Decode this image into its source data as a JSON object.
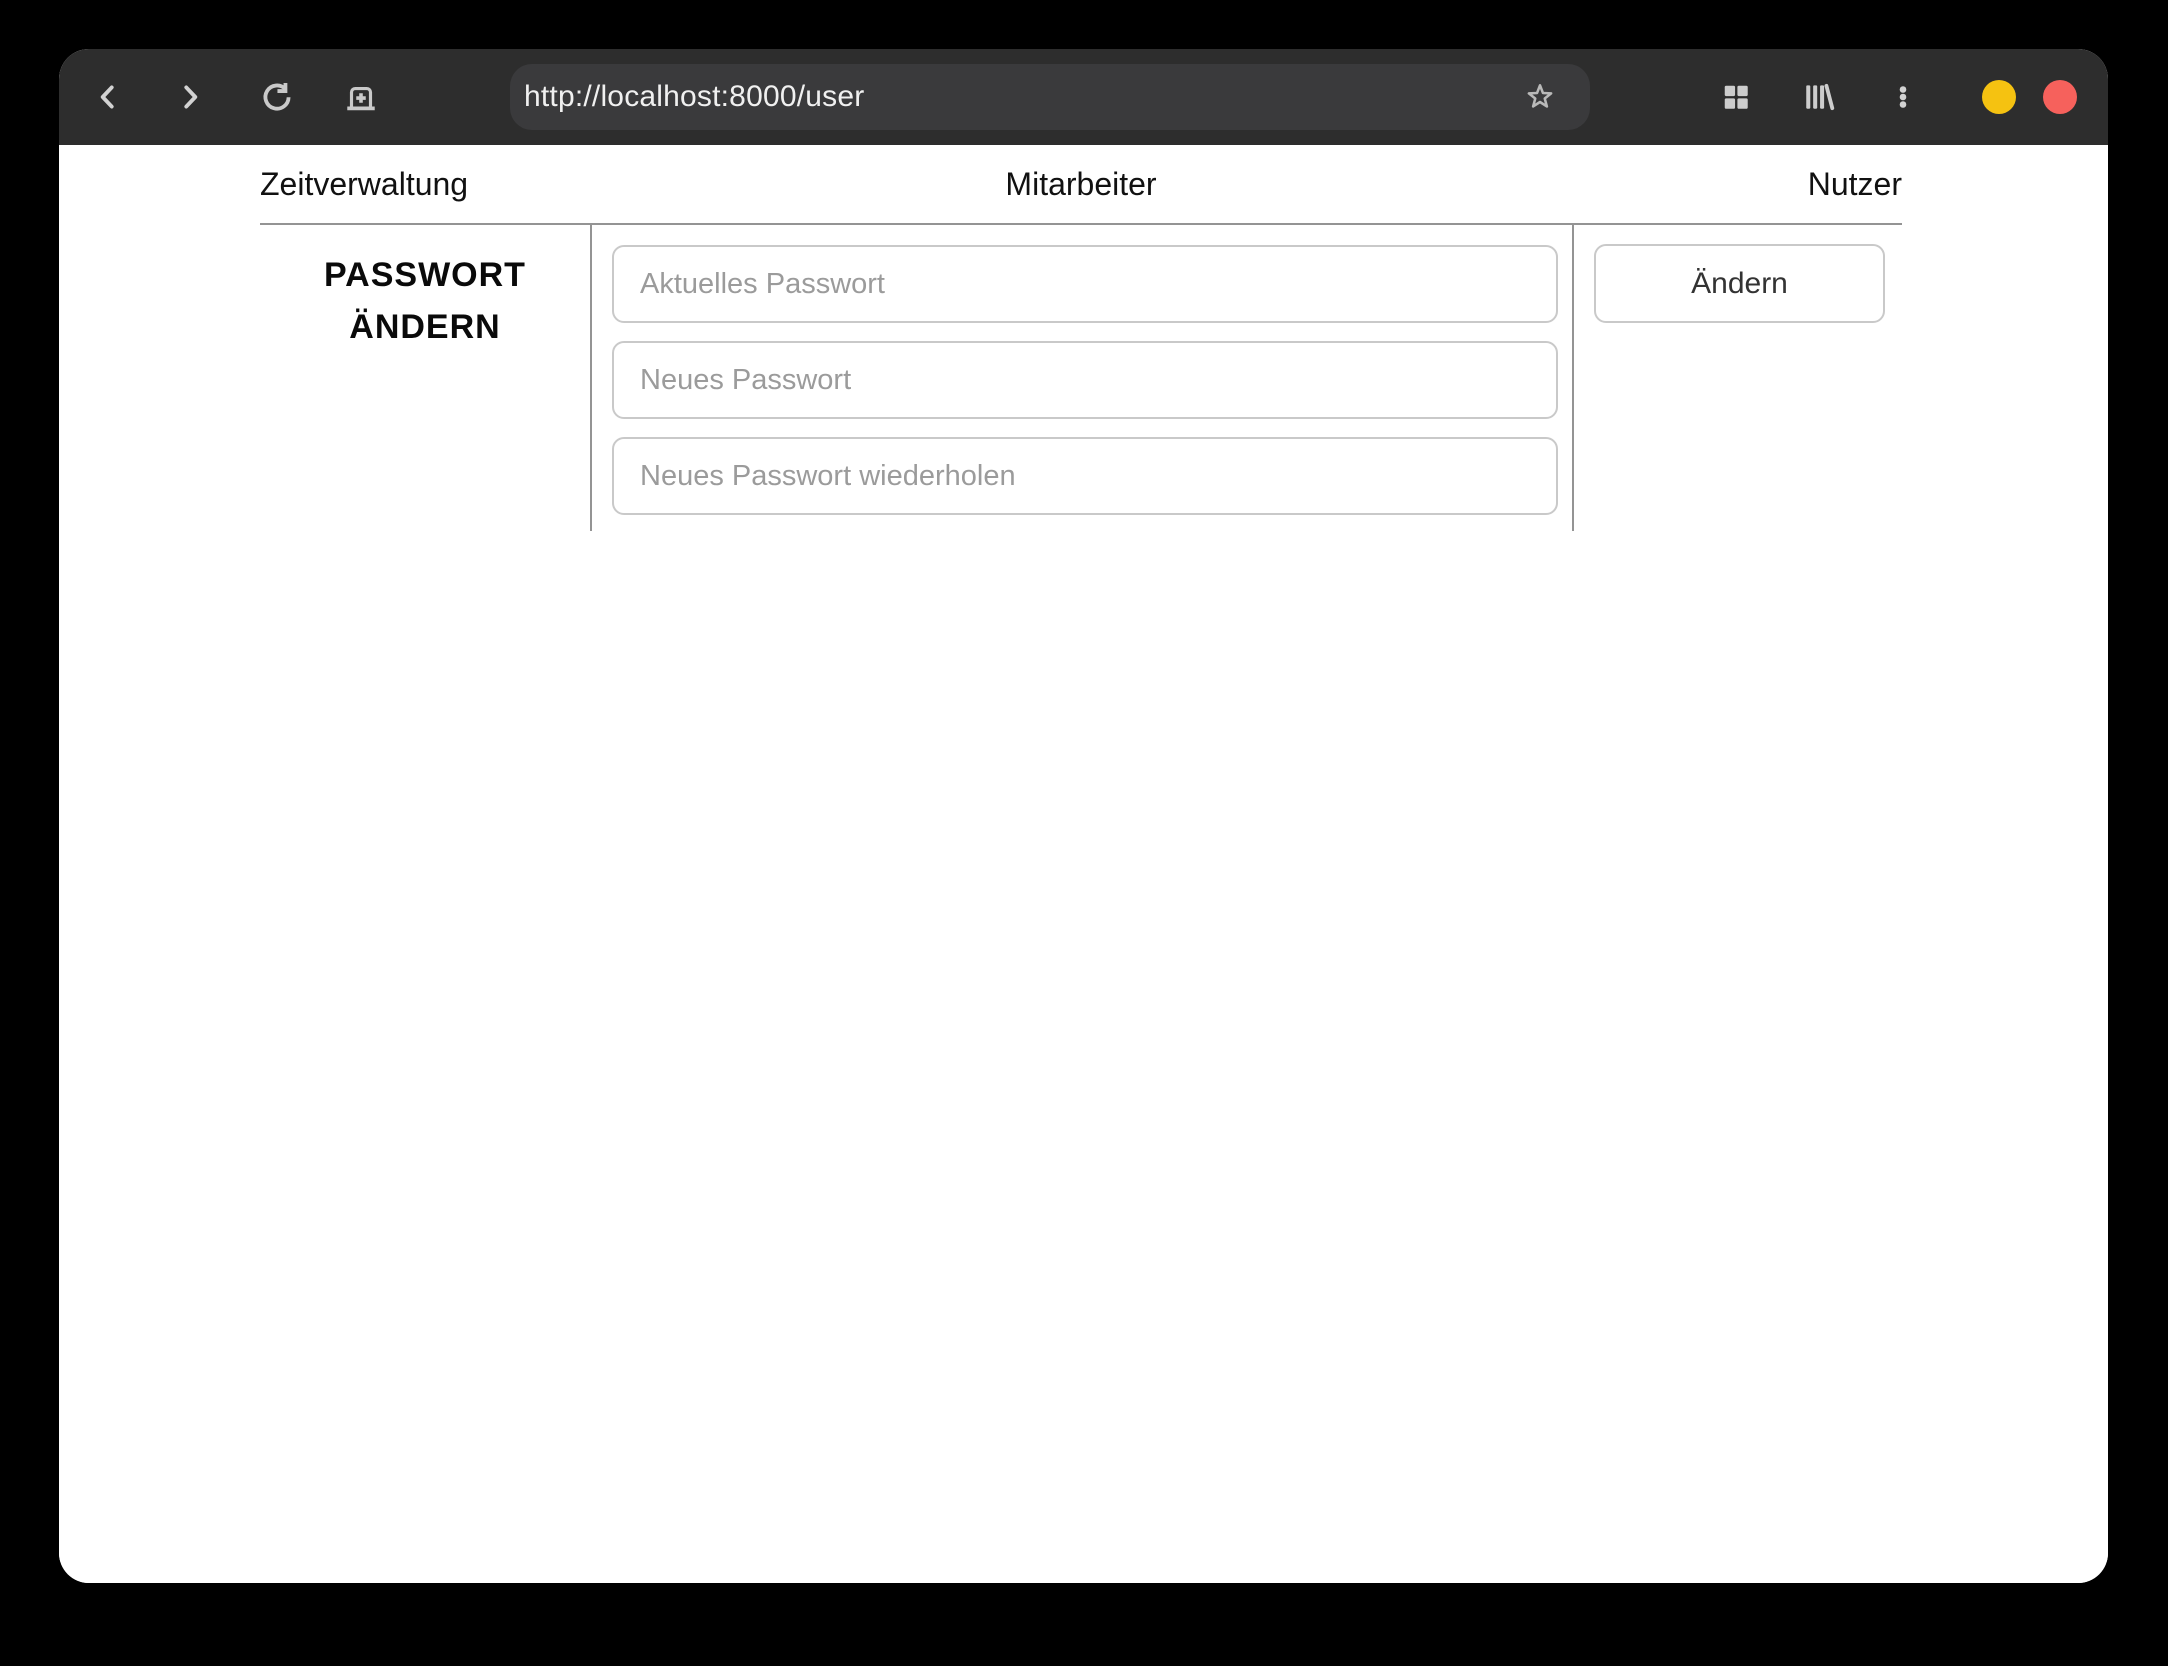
{
  "browser": {
    "toolbar": {
      "url": "http://localhost:8000/user",
      "icons": {
        "back": "chevron-left",
        "forward": "chevron-right",
        "reload": "circular-arrow",
        "new_tab": "tab-with-plus",
        "bookmark": "star-outline",
        "tab_overview": "grid-2x2",
        "library": "books-on-shelf",
        "menu": "kebab-three-dots"
      }
    },
    "window_controls": {
      "minimize": "yellow-circle",
      "close": "red-circle"
    }
  },
  "nav": {
    "items": [
      {
        "id": "zeitverwaltung",
        "label": "Zeitverwaltung"
      },
      {
        "id": "mitarbeiter",
        "label": "Mitarbeiter"
      },
      {
        "id": "nutzer",
        "label": "Nutzer"
      }
    ]
  },
  "password_form": {
    "heading_line1": "PASSWORT",
    "heading_line2": "ÄNDERN",
    "fields": [
      {
        "name": "current_password",
        "placeholder": "Aktuelles Passwort",
        "value": ""
      },
      {
        "name": "new_password",
        "placeholder": "Neues Passwort",
        "value": ""
      },
      {
        "name": "repeat_password",
        "placeholder": "Neues Passwort wiederholen",
        "value": ""
      }
    ],
    "submit_label": "Ändern"
  },
  "colors": {
    "toolbar_bg": "#2d2d2d",
    "urlbar_bg": "#3a3a3c",
    "icon_gray": "#c9c9c9",
    "minimize_yellow": "#f5c211",
    "close_red": "#f6615c",
    "table_border": "#949494",
    "input_border": "#c9c9c9",
    "placeholder_gray": "#9b9b9b"
  }
}
